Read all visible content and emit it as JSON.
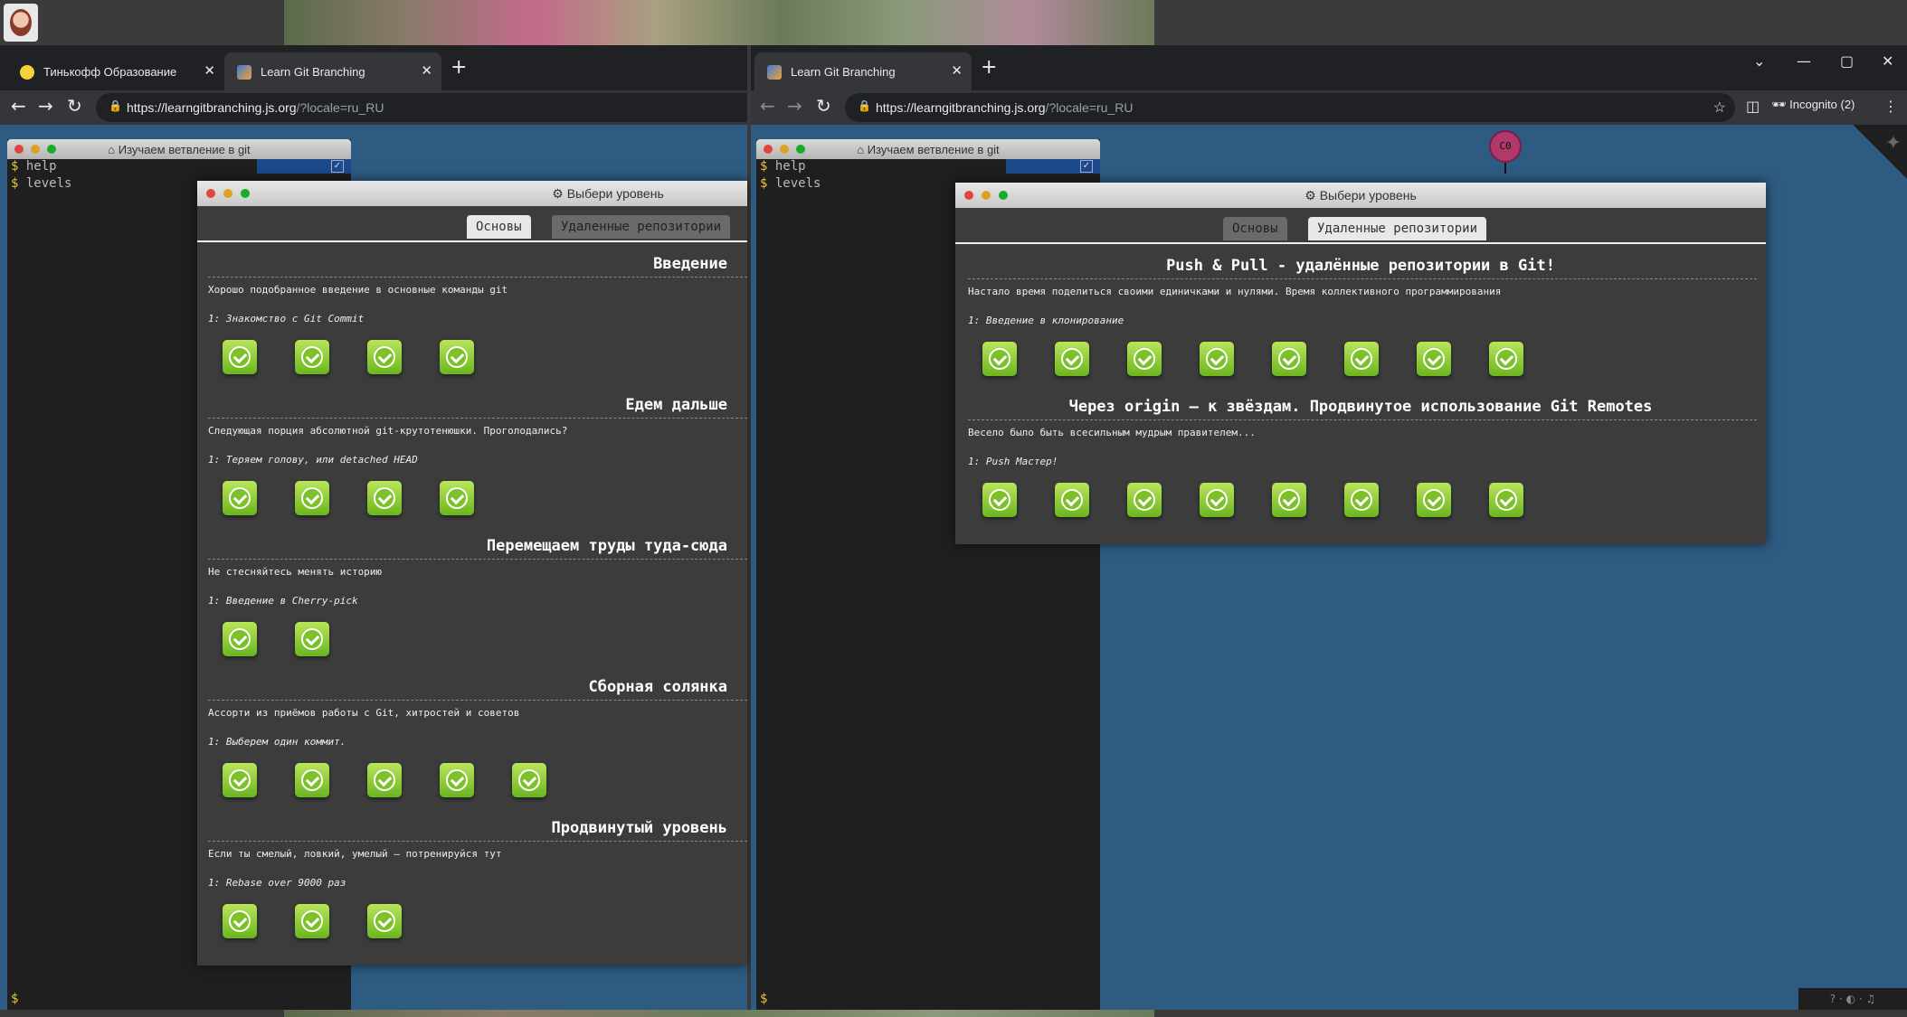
{
  "left_browser": {
    "tabs": [
      {
        "title": "Тинькофф Образование",
        "favicon": "tinkoff-icon"
      },
      {
        "title": "Learn Git Branching",
        "favicon": "learngit-icon"
      }
    ],
    "url_host": "https://learngitbranching.js.org",
    "url_path": "/?locale=ru_RU",
    "terminal": {
      "title": "Изучаем ветвление в git",
      "lines": [
        "help",
        "levels"
      ],
      "prompt": "$"
    },
    "dialog": {
      "title": "Выбери уровень",
      "tabs": [
        {
          "label": "Основы",
          "active": true
        },
        {
          "label": "Удаленные репозитории",
          "active": false
        }
      ],
      "sequences": [
        {
          "title": "Введение",
          "desc": "Хорошо подобранное введение в основные команды git",
          "level": "1: Знакомство с Git Commit",
          "count": 4
        },
        {
          "title": "Едем дальше",
          "desc": "Следующая порция абсолютной git-крутотенюшки. Проголодались?",
          "level": "1: Теряем голову, или detached HEAD",
          "count": 4
        },
        {
          "title": "Перемещаем труды туда-сюда",
          "desc": "Не стесняйтесь менять историю",
          "level": "1: Введение в Cherry-pick",
          "count": 2
        },
        {
          "title": "Сборная солянка",
          "desc": "Ассорти из приёмов работы с Git, хитростей и советов",
          "level": "1: Выберем один коммит.",
          "count": 5
        },
        {
          "title": "Продвинутый уровень",
          "desc": "Если ты смелый, ловкий, умелый – потренируйся тут",
          "level": "1: Rebase over 9000 раз",
          "count": 3
        }
      ]
    }
  },
  "right_browser": {
    "tabs": [
      {
        "title": "Learn Git Branching",
        "favicon": "learngit-icon"
      }
    ],
    "url_host": "https://learngitbranching.js.org",
    "url_path": "/?locale=ru_RU",
    "incognito_label": "Incognito (2)",
    "terminal": {
      "title": "Изучаем ветвление в git",
      "lines": [
        "help",
        "levels"
      ],
      "prompt": "$"
    },
    "commit_node": "C0",
    "dialog": {
      "title": "Выбери уровень",
      "tabs": [
        {
          "label": "Основы",
          "active": false
        },
        {
          "label": "Удаленные репозитории",
          "active": true
        }
      ],
      "sequences": [
        {
          "title": "Push & Pull - удалённые репозитории в Git!",
          "desc": "Настало время поделиться своими единичками и нулями. Время коллективного программирования",
          "level": "1: Введение в клонирование",
          "count": 8
        },
        {
          "title": "Через origin – к звёздам. Продвинутое использование Git Remotes",
          "desc": "Весело было быть всесильным мудрым правителем...",
          "level": "1: Push Мастер!",
          "count": 8
        }
      ]
    }
  },
  "colors": {
    "content_bg": "#2e5b81",
    "level_done": "#7cc02a",
    "terminal_bg": "#1f1f1f",
    "dialog_bg": "#3c3c3c"
  }
}
